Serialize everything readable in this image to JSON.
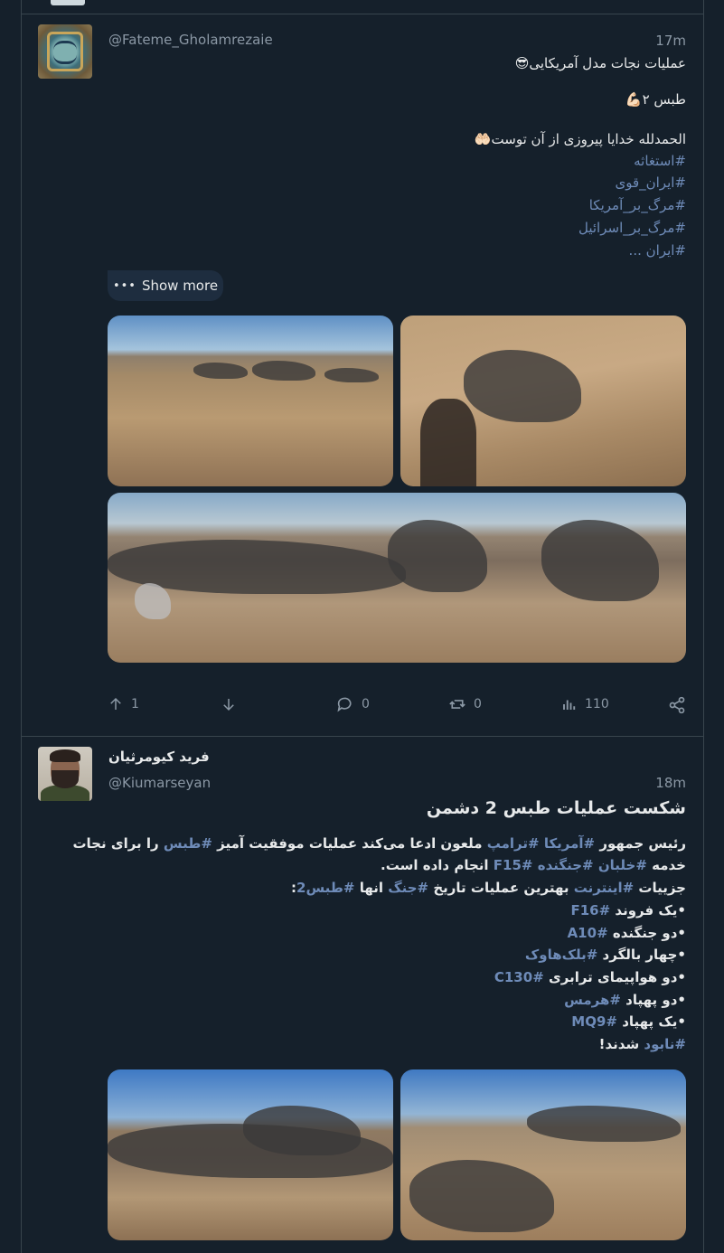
{
  "post1": {
    "handle": "@Fateme_Gholamrezaie",
    "time": "17m",
    "line1": "عملیات نجات مدل آمریکایی😎",
    "line2": "طبس ۲💪🏻",
    "line3": "الحمدلله خدایا پیروزی از آن توست🤲🏻",
    "hashtags": [
      "#استغاثه",
      "#ایران_قوی",
      "#مرگ_بر_آمریکا",
      "#مرگ_بر_اسرائیل",
      "#ایران ..."
    ],
    "show_more": "Show more",
    "stats": {
      "retweets": "1",
      "comments": "0",
      "reposts": "0",
      "views": "110"
    }
  },
  "post2": {
    "display_name": "فرید کیومرثیان",
    "handle": "@Kiumarseyan",
    "time": "18m",
    "title": "شکست عملیات طبس 2 دشمن",
    "p1_a": "رئیس جمهور ",
    "p1_t1": "#آمریکا",
    "p1_s1": " ",
    "p1_t2": "#ترامپ",
    "p1_b": " ملعون ادعا می‌کند عملیات موفقیت آمیز ",
    "p1_t3": "#طبس",
    "p1_c": " را برای نجات",
    "p2_a": "خدمه ",
    "p2_t1": "#خلبان",
    "p2_s1": " ",
    "p2_t2": "#جنگنده",
    "p2_s2": " ",
    "p2_t3": "#F15",
    "p2_b": " انجام داده است.",
    "p3_a": "جزییات ",
    "p3_t1": "#اینترنت",
    "p3_b": " بهترین عملیات تاریخ ",
    "p3_t2": "#جنگ",
    "p3_c": " انها ",
    "p3_t3": "#طبس2",
    "p3_d": ":",
    "items": [
      {
        "pre": "•یک فروند ",
        "tag": "#F16"
      },
      {
        "pre": "•دو جنگنده ",
        "tag": "#A10"
      },
      {
        "pre": "•چهار بالگرد ",
        "tag": "#بلک‌هاوک"
      },
      {
        "pre": "•دو هواپیمای ترابری ",
        "tag": "#C130"
      },
      {
        "pre": "•دو پهپاد ",
        "tag": "#هرمس"
      },
      {
        "pre": "•یک پهپاد ",
        "tag": "#MQ9"
      }
    ],
    "end_tag": "#نابود",
    "end_text": " شدند!"
  },
  "icons": [
    "retweet-up-icon",
    "download-icon",
    "comment-icon",
    "repost-icon",
    "views-icon",
    "share-icon"
  ],
  "colors": {
    "background": "#15202b",
    "hashtag": "#6e8bb8",
    "muted": "#8b98a5",
    "text": "#e7e9ea"
  }
}
